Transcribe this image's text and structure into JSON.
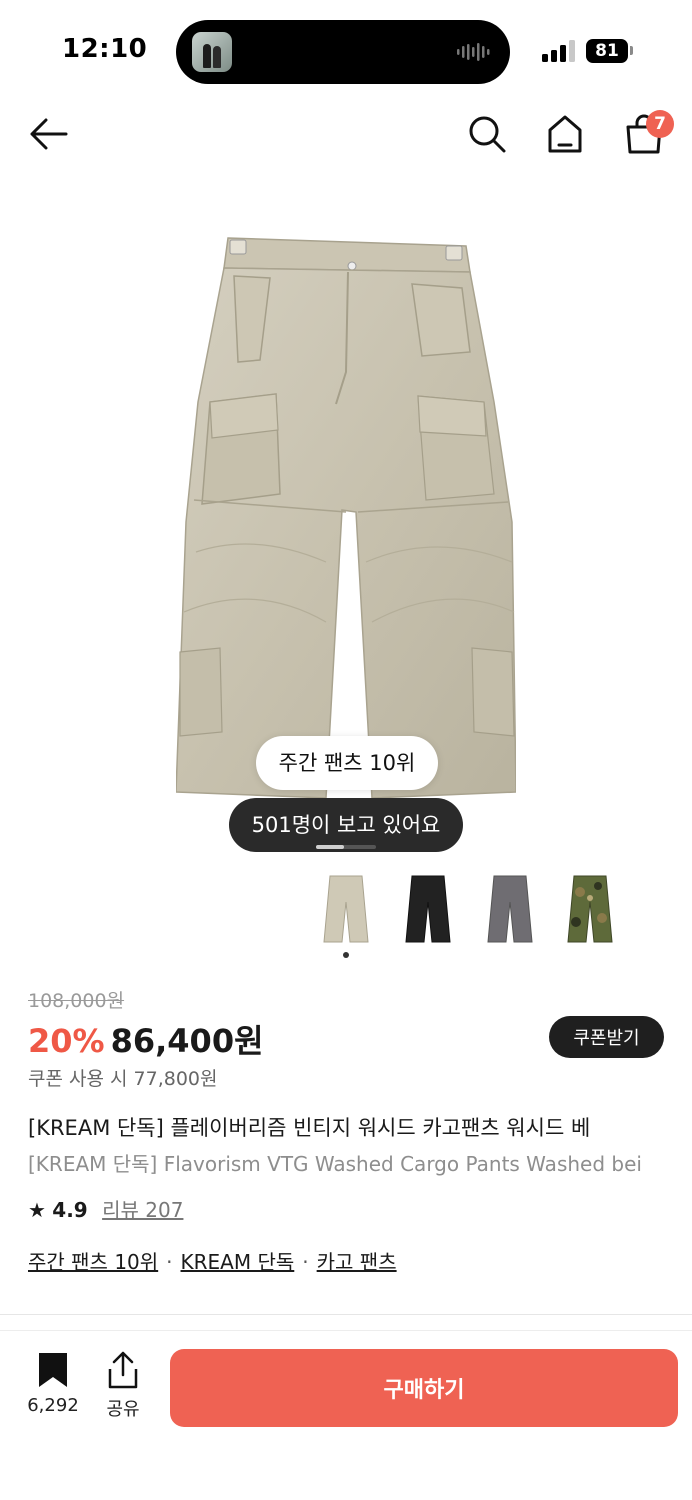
{
  "status_bar": {
    "time": "12:10",
    "battery": "81"
  },
  "nav": {
    "back_icon": "arrow-left-icon",
    "search_icon": "search-icon",
    "home_icon": "home-icon",
    "cart_icon": "shopping-bag-icon",
    "cart_badge": "7"
  },
  "product": {
    "rank_pill": "주간 팬츠 10위",
    "viewers_pill": "501명이 보고 있어요",
    "color_options": [
      "beige",
      "black",
      "gray",
      "camo"
    ],
    "original_price": "108,000원",
    "discount": "20%",
    "price": "86,400원",
    "coupon_button": "쿠폰받기",
    "coupon_price": "쿠폰 사용 시 77,800원",
    "title_ko": "[KREAM 단독] 플레이버리즘 빈티지 워시드 카고팬츠 워시드 베",
    "title_en": "[KREAM 단독] Flavorism VTG Washed Cargo Pants Washed bei",
    "rating": "4.9",
    "review_label": "리뷰 207",
    "tags": [
      "주간 팬츠 10위",
      "KREAM 단독",
      "카고 팬츠"
    ]
  },
  "bottom_bar": {
    "save_count": "6,292",
    "share_label": "공유",
    "buy_label": "구매하기"
  },
  "colors": {
    "accent": "#ef6253",
    "discount": "#ef5846",
    "dark_pill": "#2a2a2a"
  }
}
